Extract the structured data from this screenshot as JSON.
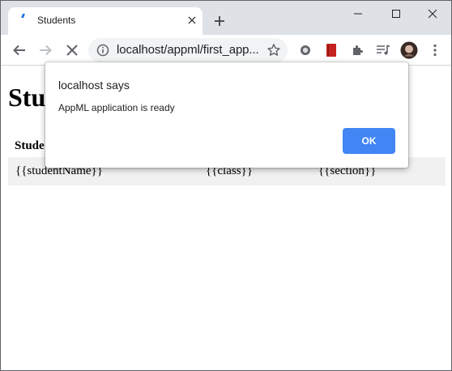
{
  "browser": {
    "tab": {
      "title": "Students"
    },
    "address_bar": {
      "url": "localhost/appml/first_app..."
    },
    "theme": {
      "tabstrip_bg": "#dee1e6",
      "accent": "#1a73e8"
    }
  },
  "page": {
    "heading": "Stu",
    "table": {
      "header_visible": "Stude",
      "row": {
        "name": "{{studentName}}",
        "class": "{{class}}",
        "section": "{{section}}"
      }
    }
  },
  "dialog": {
    "title": "localhost says",
    "message": "AppML application is ready",
    "ok_label": "OK",
    "ok_color": "#4285f4"
  },
  "icons": {
    "toolbar": [
      "back-icon",
      "forward-icon",
      "stop-loading-icon",
      "info-icon",
      "star-icon",
      "circle-extension-icon",
      "book-extension-icon",
      "puzzle-extensions-icon",
      "media-control-icon",
      "profile-avatar",
      "more-menu-icon"
    ],
    "window": [
      "minimize-icon",
      "maximize-icon",
      "close-window-icon"
    ]
  }
}
